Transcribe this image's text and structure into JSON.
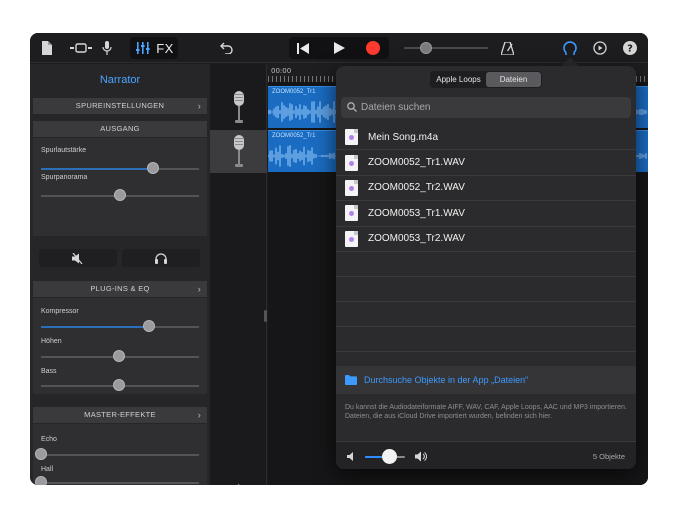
{
  "toolbar": {
    "fx_label": "FX",
    "record_color": "#ff3b30",
    "icons": [
      "document-icon",
      "track-view-icon",
      "microphone-icon",
      "mixer-icon",
      "undo-icon",
      "rewind-icon",
      "play-icon",
      "record-icon",
      "metronome-icon",
      "loop-browser-icon",
      "settings-icon",
      "help-icon"
    ]
  },
  "inspector": {
    "title": "Narrator",
    "track_settings": "SPUREINSTELLUNGEN",
    "output": {
      "header": "AUSGANG",
      "volume_label": "Spurlautstärke",
      "volume_level": 0.72,
      "pan_label": "Spurpanorama",
      "pan_level": 0.5
    },
    "plugins": {
      "header": "PLUG-INS & EQ",
      "compressor_label": "Kompressor",
      "compressor_level": 0.7,
      "treble_label": "Höhen",
      "treble_level": 0.5,
      "bass_label": "Bass",
      "bass_level": 0.5
    },
    "master": {
      "header": "MASTER-EFFEKTE",
      "echo_label": "Echo",
      "echo_level": 0.0,
      "reverb_label": "Hall",
      "reverb_level": 0.0
    }
  },
  "timeline": {
    "ruler_start": "00:00",
    "regions": [
      {
        "name": "ZOOM0052_Tr1"
      },
      {
        "name": "ZOOM0052_Tr1"
      }
    ],
    "region_color": "#1a6cc2"
  },
  "add_track_label": "+",
  "popover": {
    "tabs": [
      {
        "label": "Apple Loops",
        "active": false
      },
      {
        "label": "Dateien",
        "active": true
      }
    ],
    "search_placeholder": "Dateien suchen",
    "files": [
      {
        "name": "Mein Song.m4a"
      },
      {
        "name": "ZOOM0052_Tr1.WAV"
      },
      {
        "name": "ZOOM0052_Tr2.WAV"
      },
      {
        "name": "ZOOM0053_Tr1.WAV"
      },
      {
        "name": "ZOOM0053_Tr2.WAV"
      }
    ],
    "browse_label": "Durchsuche Objekte in der App „Dateien“",
    "info_text": "Du kannst die Audiodateiformate AIFF, WAV, CAF, Apple Loops, AAC und MP3 importieren. Dateien, die aus iCloud Drive importiert wurden, befinden sich hier.",
    "preview_volume": 0.6,
    "count_label": "5 Objekte",
    "accent_color": "#3d9bff"
  }
}
